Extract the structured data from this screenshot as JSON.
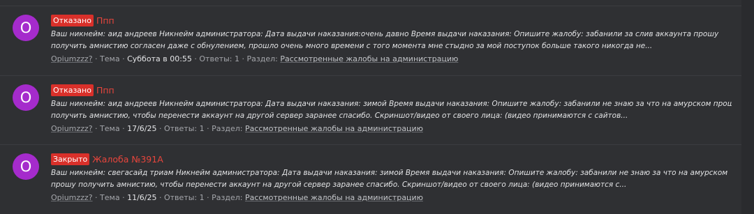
{
  "threads": [
    {
      "avatar_letter": "O",
      "status": "Отказано",
      "title": "Ппп",
      "snippet_line1": "Ваш никнейм: аид андреев Никнейм администратора: Дата выдачи наказания:очень давно Время выдачи наказания: Опишите жалобу: забанили за слив аккаунта прошу",
      "snippet_line2": "получить амнистию согласен даже с обнулением, прошло очень много времени с того момента мне стыдно за мой поступок больше такого никогда не...",
      "author": "Opiumzzz?",
      "type_label": "Тема",
      "date": "Суббота в 00:55",
      "replies_label": "Ответы: 1",
      "forum_label": "Раздел:",
      "forum": "Рассмотренные жалобы на администрацию"
    },
    {
      "avatar_letter": "O",
      "status": "Отказано",
      "title": "Ппп",
      "snippet_line1": "Ваш никнейм: аид андреев Никнейм администратора: Дата выдачи наказания: зимой Время выдачи наказания: Опишите жалобу: забанили не знаю за что на амурском прошу",
      "snippet_line2": "получить амнистию, чтобы перенести аккаунт на другой сервер заранее спасибо. Скриншот/видео от своего лица: (видео принимаются с сайтов...",
      "author": "Opiumzzz?",
      "type_label": "Тема",
      "date": "17/6/25",
      "replies_label": "Ответы: 1",
      "forum_label": "Раздел:",
      "forum": "Рассмотренные жалобы на администрацию"
    },
    {
      "avatar_letter": "O",
      "status": "Закрыто",
      "title": "Жалоба №391А",
      "snippet_line1": "Ваш никнейм: свегасайд триам Никнейм администратора: Дата выдачи наказания: зимой Время выдачи наказания: Опишите жалобу: забанили не знаю за что на амурском",
      "snippet_line2": "прошу получить амнистию, чтобы перенести аккаунт на другой сервер заранее спасибо. Скриншот/видео от своего лица: (видео принимаются с...",
      "author": "Opiumzzz?",
      "type_label": "Тема",
      "date": "11/6/25",
      "replies_label": "Ответы: 1",
      "forum_label": "Раздел:",
      "forum": "Рассмотренные жалобы на администрацию"
    }
  ],
  "colors": {
    "avatar": "#a52bcc",
    "badge": "#d9302a",
    "title": "#e8453c"
  }
}
